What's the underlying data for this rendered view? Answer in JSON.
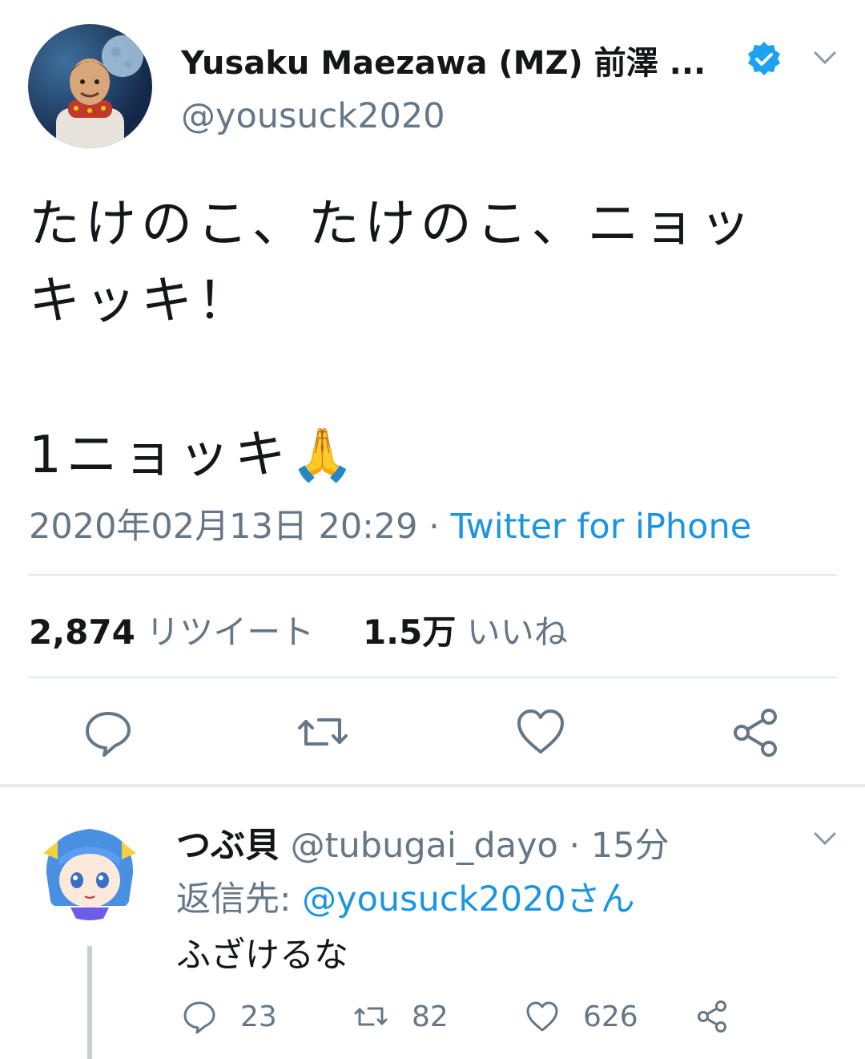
{
  "tweet": {
    "author": {
      "display_name": "Yusaku Maezawa (MZ) 前澤 ...",
      "handle": "@yousuck2020"
    },
    "text_lines": [
      "たけのこ、たけのこ、ニョッ",
      "キッキ！",
      "",
      "1ニョッキ🙏"
    ],
    "timestamp": "2020年02月13日 20:29",
    "separator": " · ",
    "via": "Twitter for iPhone",
    "stats": {
      "retweets_count": "2,874",
      "retweets_label": "リツイート",
      "likes_count": "1.5万",
      "likes_label": "いいね"
    },
    "actions": [
      "reply-icon",
      "retweet-icon",
      "like-icon",
      "share-icon"
    ]
  },
  "reply": {
    "display_name": "つぶ貝",
    "handle": "@tubugai_dayo",
    "separator": " · ",
    "time": "15分",
    "reply_to_label": "返信先: ",
    "reply_to_mention": "@yousuck2020さん",
    "text": "ふざけるな",
    "counts": {
      "replies": "23",
      "retweets": "82",
      "likes": "626"
    }
  },
  "colors": {
    "accent": "#1b95e0",
    "secondary_text": "#657786",
    "divider": "#e1e8ed"
  }
}
